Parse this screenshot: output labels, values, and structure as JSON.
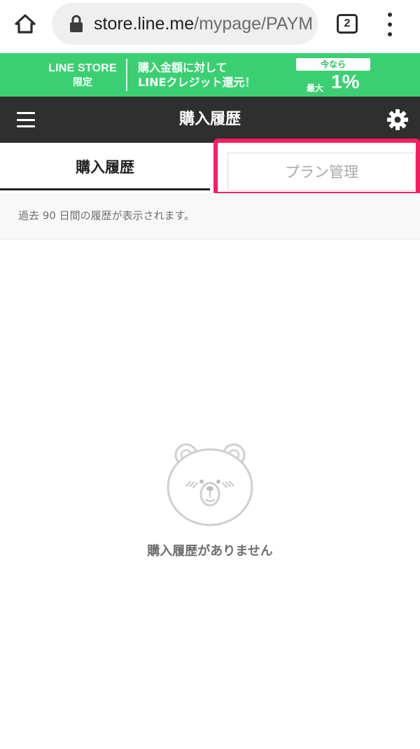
{
  "browser": {
    "url_domain": "store.line.me",
    "url_path": "/mypage/PAYM",
    "tab_count": "2",
    "icons": [
      "home-icon",
      "lock-icon",
      "tabs-icon",
      "more-vert-icon"
    ]
  },
  "promo": {
    "store_line1": "LINE STORE",
    "store_line2": "限定",
    "message_line1": "購入金額に対して",
    "message_line2": "LINEクレジット還元！",
    "badge_now": "今なら",
    "badge_max": "最大",
    "badge_percent": "1%",
    "color": "#3ad072"
  },
  "header": {
    "title": "購入履歴",
    "icons": [
      "menu-icon",
      "gear-icon"
    ],
    "color": "#2f2f2f"
  },
  "tabs": {
    "history": "購入履歴",
    "plan": "プラン管理",
    "highlight_color": "#ff1b63"
  },
  "notice": {
    "text": "過去 90 日間の履歴が表示されます。"
  },
  "empty": {
    "icon": "bear-face-icon",
    "message": "購入履歴がありません"
  }
}
